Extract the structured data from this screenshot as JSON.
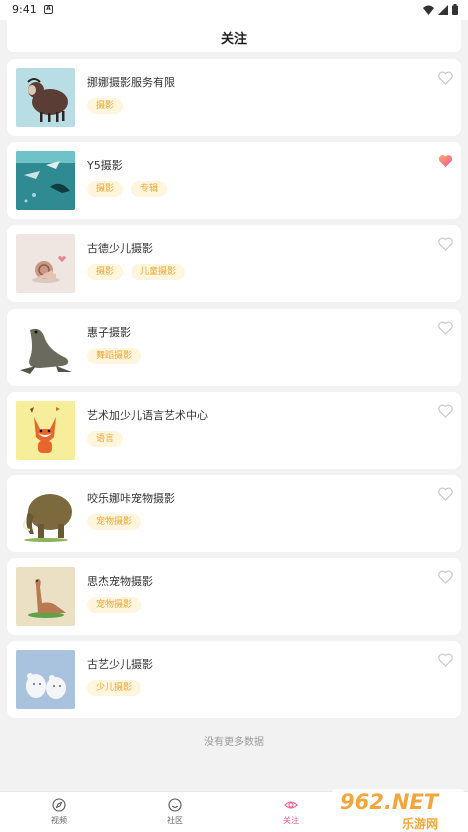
{
  "status": {
    "time": "9:41",
    "notification_icon": "A"
  },
  "header": {
    "title": "关注"
  },
  "items": [
    {
      "name": "挪娜摄影服务有限",
      "tags": [
        "摄影"
      ],
      "liked": false,
      "thumb_bg": "#b9dde4"
    },
    {
      "name": "Y5摄影",
      "tags": [
        "摄影",
        "专辑"
      ],
      "liked": true,
      "thumb_bg": "#2f8a92"
    },
    {
      "name": "古德少儿摄影",
      "tags": [
        "摄影",
        "儿童摄影"
      ],
      "liked": false,
      "thumb_bg": "#efe6e2"
    },
    {
      "name": "惠子摄影",
      "tags": [
        "舞蹈摄影"
      ],
      "liked": false,
      "thumb_bg": "#ffffff"
    },
    {
      "name": "艺术加少儿语言艺术中心",
      "tags": [
        "语言"
      ],
      "liked": false,
      "thumb_bg": "#f7ee9c"
    },
    {
      "name": "咬乐娜咔宠物摄影",
      "tags": [
        "宠物摄影"
      ],
      "liked": false,
      "thumb_bg": "#ffffff"
    },
    {
      "name": "思杰宠物摄影",
      "tags": [
        "宠物摄影"
      ],
      "liked": false,
      "thumb_bg": "#ece0c4"
    },
    {
      "name": "古艺少儿摄影",
      "tags": [
        "少儿摄影"
      ],
      "liked": false,
      "thumb_bg": "#a9c3de"
    }
  ],
  "footer_text": "没有更多数据",
  "tabbar": {
    "tabs": [
      {
        "label": "视频",
        "icon": "compass-icon",
        "active": false
      },
      {
        "label": "社区",
        "icon": "smile-icon",
        "active": false
      },
      {
        "label": "关注",
        "icon": "eye-icon",
        "active": true
      }
    ]
  },
  "watermark": {
    "text": "962.NET",
    "sub": "乐游网"
  },
  "colors": {
    "tag_bg": "#fff6dd",
    "tag_text": "#f2a530",
    "accent": "#ef5a8e",
    "heart_filled": "#f07aa0"
  }
}
